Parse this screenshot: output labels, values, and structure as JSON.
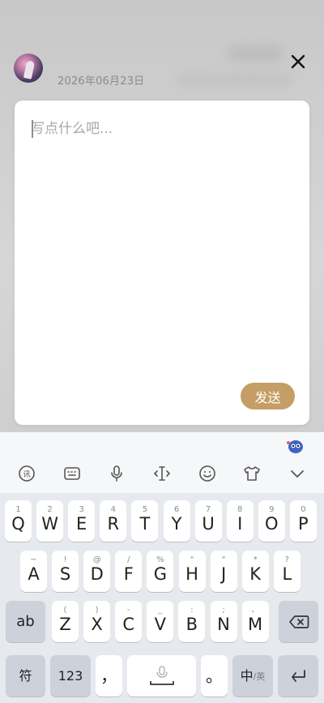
{
  "header": {
    "date": "2026年06月23日",
    "avatar": "avatar-icon",
    "close_icon": "close-icon"
  },
  "composer": {
    "placeholder": "写点什么吧...",
    "send_label": "发送",
    "accent": "#c49e65"
  },
  "keyboard": {
    "toolbar": [
      "voice-input-icon",
      "keyboard-layout-icon",
      "microphone-icon",
      "cursor-move-icon",
      "emoji-icon",
      "clipboard-shirt-icon",
      "collapse-chevron-icon"
    ],
    "row1": [
      {
        "k": "Q",
        "s": "1"
      },
      {
        "k": "W",
        "s": "2"
      },
      {
        "k": "E",
        "s": "3"
      },
      {
        "k": "R",
        "s": "4"
      },
      {
        "k": "T",
        "s": "5"
      },
      {
        "k": "Y",
        "s": "6"
      },
      {
        "k": "U",
        "s": "7"
      },
      {
        "k": "I",
        "s": "8"
      },
      {
        "k": "O",
        "s": "9"
      },
      {
        "k": "P",
        "s": "0"
      }
    ],
    "row2": [
      {
        "k": "A",
        "s": "~"
      },
      {
        "k": "S",
        "s": "!"
      },
      {
        "k": "D",
        "s": "@"
      },
      {
        "k": "F",
        "s": "/"
      },
      {
        "k": "G",
        "s": "%"
      },
      {
        "k": "H",
        "s": "\""
      },
      {
        "k": "J",
        "s": "\""
      },
      {
        "k": "K",
        "s": "*"
      },
      {
        "k": "L",
        "s": "?"
      }
    ],
    "row3": [
      {
        "k": "Z",
        "s": "("
      },
      {
        "k": "X",
        "s": ")"
      },
      {
        "k": "C",
        "s": "-"
      },
      {
        "k": "V",
        "s": "_"
      },
      {
        "k": "B",
        "s": ":"
      },
      {
        "k": "N",
        "s": ";"
      },
      {
        "k": "M",
        "s": "、"
      }
    ],
    "shift_label": "ab",
    "symbols_label": "符",
    "numbers_label": "123",
    "comma_label": "，",
    "period_label": "。",
    "lang_main": "中",
    "lang_sub": "/英"
  }
}
